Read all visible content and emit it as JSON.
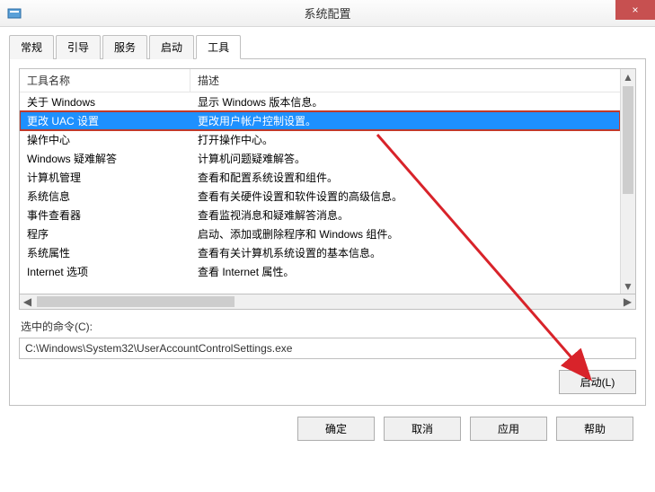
{
  "window": {
    "title": "系统配置",
    "close": "×"
  },
  "tabs": [
    {
      "label": "常规"
    },
    {
      "label": "引导"
    },
    {
      "label": "服务"
    },
    {
      "label": "启动"
    },
    {
      "label": "工具"
    }
  ],
  "active_tab_index": 4,
  "list": {
    "headers": {
      "name": "工具名称",
      "desc": "描述"
    },
    "rows": [
      {
        "name": "关于 Windows",
        "desc": "显示 Windows 版本信息。"
      },
      {
        "name": "更改 UAC 设置",
        "desc": "更改用户帐户控制设置。",
        "selected": true
      },
      {
        "name": "操作中心",
        "desc": "打开操作中心。"
      },
      {
        "name": "Windows 疑难解答",
        "desc": "计算机问题疑难解答。"
      },
      {
        "name": "计算机管理",
        "desc": "查看和配置系统设置和组件。"
      },
      {
        "name": "系统信息",
        "desc": "查看有关硬件设置和软件设置的高级信息。"
      },
      {
        "name": "事件查看器",
        "desc": "查看监视消息和疑难解答消息。"
      },
      {
        "name": "程序",
        "desc": "启动、添加或删除程序和 Windows 组件。"
      },
      {
        "name": "系统属性",
        "desc": "查看有关计算机系统设置的基本信息。"
      },
      {
        "name": "Internet 选项",
        "desc": "查看 Internet 属性。"
      }
    ]
  },
  "selected_command_label": "选中的命令(C):",
  "selected_command_value": "C:\\Windows\\System32\\UserAccountControlSettings.exe",
  "buttons": {
    "launch": "启动(L)",
    "ok": "确定",
    "cancel": "取消",
    "apply": "应用",
    "help": "帮助"
  },
  "scroll_glyphs": {
    "up": "▲",
    "down": "▼",
    "left": "◀",
    "right": "▶"
  }
}
